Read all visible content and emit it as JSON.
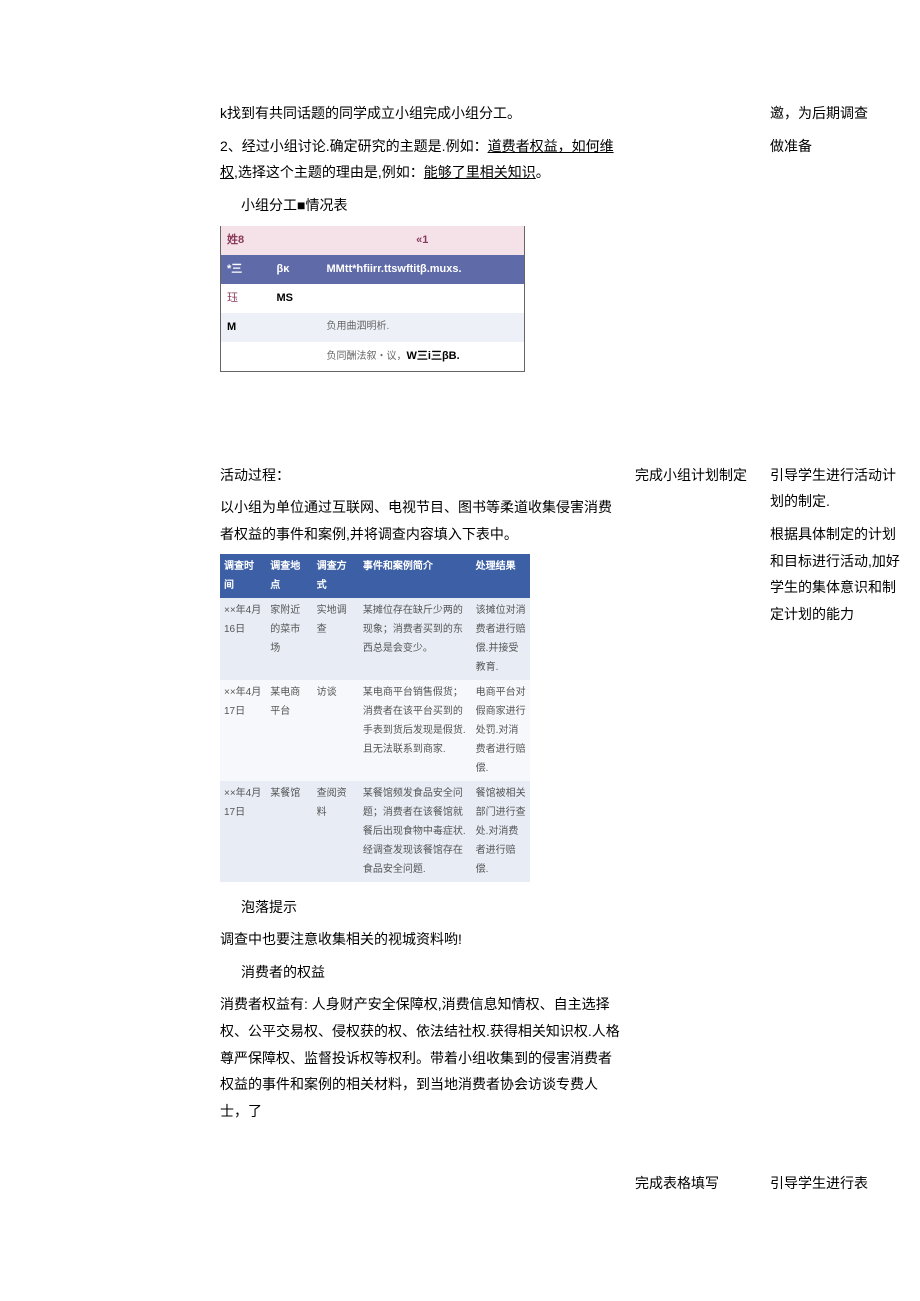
{
  "section1": {
    "p1": "k找到有共同话题的同学成立小组完成小组分工。",
    "p2a": "2、经过小组讨论.确定研究的主题是.例如：",
    "p2u1": "道费者权益，如何维权",
    "p2b": ",选择这个主题的理由是,例如：",
    "p2u2": "能够了里相关知识",
    "p2c": "。",
    "p3": "小组分工■情况表"
  },
  "side1": {
    "r1": "邀，为后期调查",
    "r2": "做准备"
  },
  "table1": {
    "head": {
      "c1": "姓8",
      "c2": "",
      "c3": "«1"
    },
    "r1": {
      "c1": "*三",
      "c2": "βκ",
      "c3": "MMtt*hfiirr.ttswftitβ.muxs."
    },
    "r2": {
      "c1": "珏",
      "c2": "MS",
      "c3": ""
    },
    "r3": {
      "c1": "M",
      "c2": "",
      "c3": "负用曲泗明析."
    },
    "r4": {
      "c1": "",
      "c2": "",
      "c3a": "负同酬法叙・议，",
      "c3b": "W三i三βB."
    }
  },
  "section2": {
    "p1": "活动过程：",
    "p2": "以小组为单位通过互联网、电视节目、图书等柔道收集侵害消费者权益的事件和案例,并将调查内容填入下表中。"
  },
  "mid2": {
    "r1": "完成小组计划制定"
  },
  "side2": {
    "r1": "引导学生进行活动计划的制定.",
    "r2": "根据具体制定的计划和目标进行活动,加好学生的集体意识和制定计划的能力"
  },
  "table2": {
    "head": {
      "c1": "调查时间",
      "c2": "调查地点",
      "c3": "调查方式",
      "c4": "事件和案例简介",
      "c5": "处理结果"
    },
    "rows": [
      {
        "c1": "××年4月16日",
        "c2": "家附近的菜市场",
        "c3": "实地调查",
        "c4": "某摊位存在缺斤少两的现象；消费者买到的东西总是会变少。",
        "c5": "该摊位对消费者进行赔偿.并接受教育."
      },
      {
        "c1": "××年4月17日",
        "c2": "某电商平台",
        "c3": "访谈",
        "c4": "某电商平台销售假货；消费者在该平台买到的手表到货后发现是假货.且无法联系到商家.",
        "c5": "电商平台对假商家进行处罚.对消费者进行赔偿."
      },
      {
        "c1": "××年4月17日",
        "c2": "某餐馆",
        "c3": "查阅资料",
        "c4": "某餐馆频发食品安全问题；消费者在该餐馆就餐后出现食物中毒症状.经调查发现该餐馆存在食品安全问题.",
        "c5": "餐馆被相关部门进行查处.对消费者进行赔偿."
      }
    ]
  },
  "section3": {
    "p1": "泡落提示",
    "p2": "调查中也要注意收集相关的视城资料哟!",
    "p3": "消费者的权益",
    "p4": "消费者权益有: 人身财产安全保障权,消费信息知情权、自主选择权、公平交易权、侵权获的权、依法结社权.获得相关知识权.人格尊严保障权、监督投诉权等权利。带着小组收集到的侵害消费者权益的事件和案例的相关材料，到当地消费者协会访谈专费人士，了"
  },
  "mid3": {
    "r1": "完成表格填写"
  },
  "side3": {
    "r1": "引导学生进行表"
  }
}
